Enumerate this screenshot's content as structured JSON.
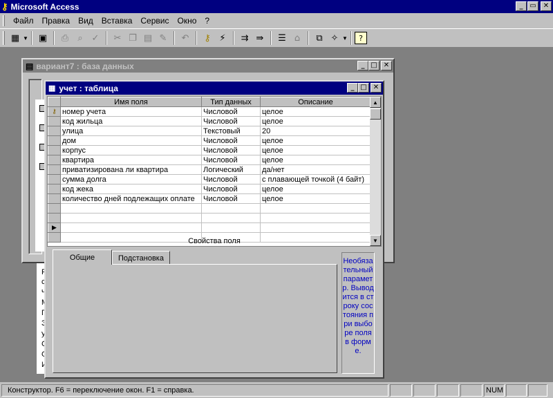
{
  "app": {
    "title": "Microsoft Access"
  },
  "window_controls": {
    "minimize": "_",
    "maximize": "□",
    "restore": "▭",
    "close": "✕"
  },
  "menubar": [
    "Файл",
    "Правка",
    "Вид",
    "Вставка",
    "Сервис",
    "Окно",
    "?"
  ],
  "toolbar": [
    "view-icon",
    "save-icon",
    "print-icon",
    "print-preview-icon",
    "spelling-icon",
    "cut-icon",
    "copy-icon",
    "paste-icon",
    "format-painter-icon",
    "undo-icon",
    "primary-key-icon",
    "indexes-icon",
    "insert-rows-icon",
    "delete-rows-icon",
    "properties-icon",
    "build-icon",
    "database-window-icon",
    "new-object-icon",
    "help-icon"
  ],
  "db_window": {
    "title": "вариант7 : база данных"
  },
  "behind_letters": [
    "Р",
    "с",
    "ч",
    "М",
    "П",
    "З",
    "у",
    "С",
    "О",
    "И"
  ],
  "table_window": {
    "title": "учет : таблица",
    "columns": [
      "Имя поля",
      "Тип данных",
      "Описание"
    ],
    "rows": [
      {
        "name": "номер учета",
        "type": "Числовой",
        "desc": "целое",
        "key": true
      },
      {
        "name": "код жильца",
        "type": "Числовой",
        "desc": "целое"
      },
      {
        "name": "улица",
        "type": "Текстовый",
        "desc": "20"
      },
      {
        "name": "дом",
        "type": "Числовой",
        "desc": "целое"
      },
      {
        "name": "корпус",
        "type": "Числовой",
        "desc": "целое"
      },
      {
        "name": "квартира",
        "type": "Числовой",
        "desc": "целое"
      },
      {
        "name": "приватизирована ли квартира",
        "type": "Логический",
        "desc": "да/нет"
      },
      {
        "name": "сумма долга",
        "type": "Числовой",
        "desc": "с плавающей точкой (4 байт)"
      },
      {
        "name": "код жека",
        "type": "Числовой",
        "desc": "целое"
      },
      {
        "name": "количество дней подлежащих оплате",
        "type": "Числовой",
        "desc": "целое"
      },
      {
        "name": "",
        "type": "",
        "desc": ""
      },
      {
        "name": "",
        "type": "",
        "desc": ""
      },
      {
        "name": "",
        "type": "",
        "desc": "",
        "current": true
      },
      {
        "name": "",
        "type": "",
        "desc": ""
      }
    ],
    "props_header": "Свойства поля",
    "tabs": [
      "Общие",
      "Подстановка"
    ],
    "help": "Необязательный параметр. Выводится в строку состояния при выборе поля в форме."
  },
  "statusbar": {
    "text": "Конструктор.  F6 = переключение окон.  F1 = справка.",
    "num": "NUM"
  }
}
